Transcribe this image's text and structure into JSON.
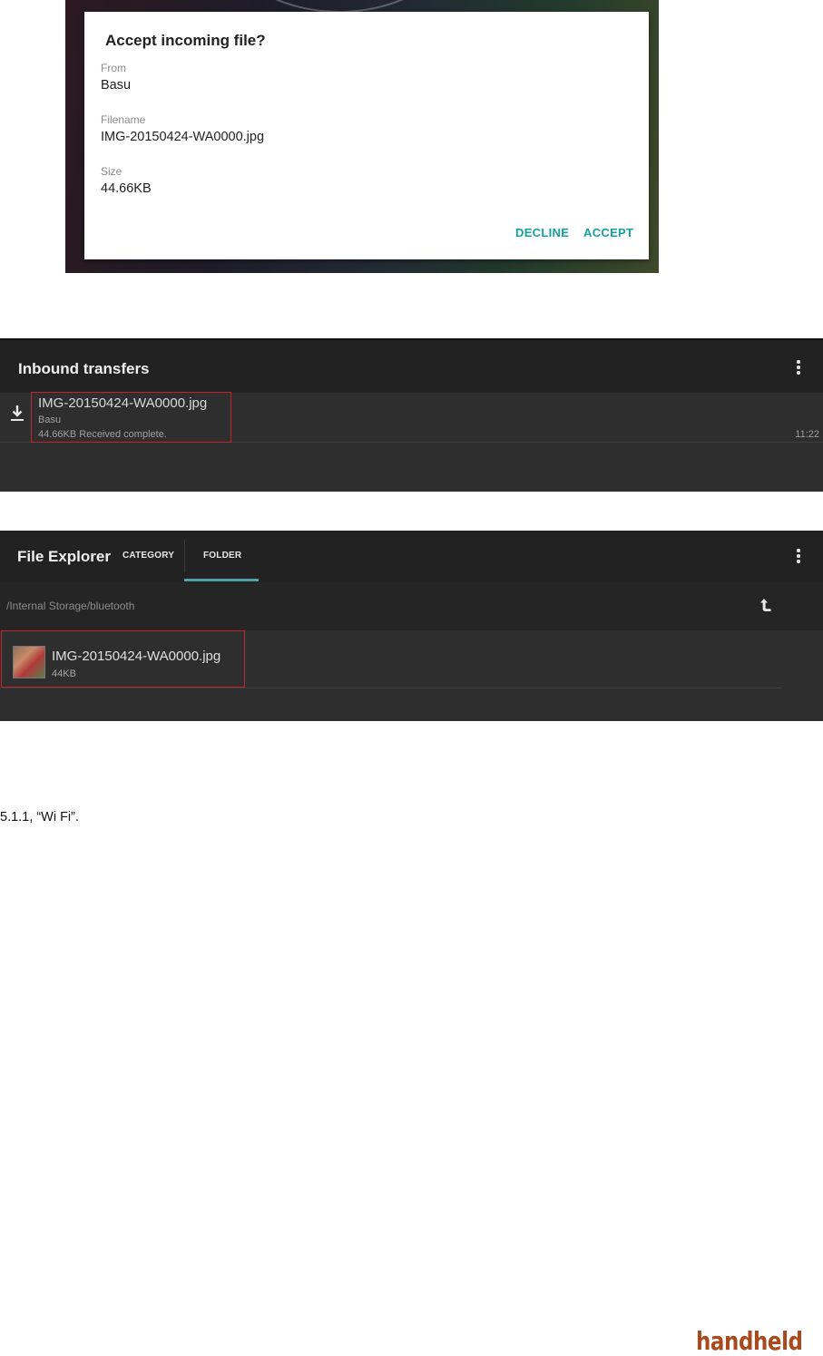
{
  "accept_dialog": {
    "title": "Accept incoming file?",
    "from_label": "From",
    "from_value": "Basu",
    "filename_label": "Filename",
    "filename_value": "IMG-20150424-WA0000.jpg",
    "size_label": "Size",
    "size_value": "44.66KB",
    "decline_label": "DECLINE",
    "accept_label": "ACCEPT",
    "accent_color": "#13a1a0"
  },
  "inbound_transfers": {
    "title": "Inbound transfers",
    "item": {
      "icon": "download-icon",
      "name": "IMG-20150424-WA0000.jpg",
      "from": "Basu",
      "status": "44.66KB Received complete.",
      "time": "11:22"
    }
  },
  "file_explorer": {
    "title": "File Explorer",
    "tabs": [
      "CATEGORY",
      "FOLDER"
    ],
    "active_tab": "FOLDER",
    "path": "/Internal Storage/bluetooth",
    "item": {
      "icon": "image-thumbnail",
      "name": "IMG-20150424-WA0000.jpg",
      "size": "44KB"
    }
  },
  "body_text": {
    "section_reference": "5.1.1, “Wi Fi”."
  },
  "logo": {
    "text": "handheld",
    "color": "#a94a1c"
  }
}
